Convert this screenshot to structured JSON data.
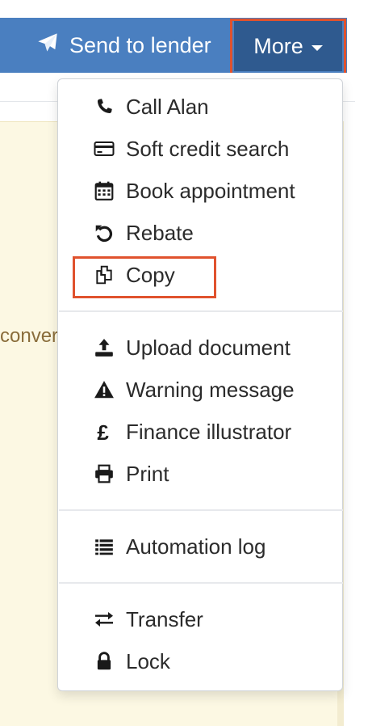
{
  "toolbar": {
    "send_label": "Send to lender",
    "more_label": "More",
    "send_icon": "paper-plane-icon",
    "more_icon": "caret-down-icon"
  },
  "background": {
    "partial_text": "conver"
  },
  "menu": {
    "groups": [
      [
        {
          "label": "Call Alan",
          "icon": "phone-icon"
        },
        {
          "label": "Soft credit search",
          "icon": "credit-card-icon"
        },
        {
          "label": "Book appointment",
          "icon": "calendar-icon"
        },
        {
          "label": "Rebate",
          "icon": "undo-icon"
        },
        {
          "label": "Copy",
          "icon": "copy-icon"
        }
      ],
      [
        {
          "label": "Upload document",
          "icon": "upload-icon"
        },
        {
          "label": "Warning message",
          "icon": "warning-icon"
        },
        {
          "label": "Finance illustrator",
          "icon": "pound-icon"
        },
        {
          "label": "Print",
          "icon": "print-icon"
        }
      ],
      [
        {
          "label": "Automation log",
          "icon": "list-icon"
        }
      ],
      [
        {
          "label": "Transfer",
          "icon": "transfer-icon"
        },
        {
          "label": "Lock",
          "icon": "lock-icon"
        }
      ]
    ]
  },
  "colors": {
    "toolbar": "#4a7fc0",
    "more_button": "#2f5a8f",
    "highlight": "#e0522e",
    "panel": "#fcf8e3",
    "panel_text": "#8a6d3b"
  }
}
